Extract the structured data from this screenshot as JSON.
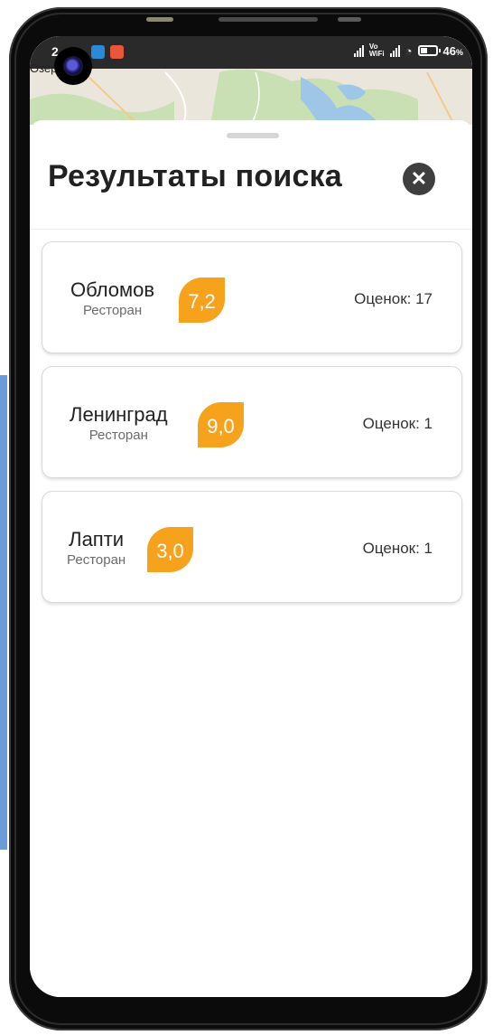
{
  "status_bar": {
    "time": "2",
    "vowifi_line1": "Vo",
    "vowifi_line2": "WiFi",
    "battery_percent": "46",
    "battery_unit": "%",
    "battery_level": 0.46
  },
  "map": {
    "label": "Озер    е"
  },
  "sheet": {
    "title": "Результаты поиска",
    "close_icon": "close-icon"
  },
  "results": [
    {
      "name": "Обломов",
      "type": "Ресторан",
      "rating": "7,2",
      "ratings_count": "Оценок: 17"
    },
    {
      "name": "Ленинград",
      "type": "Ресторан",
      "rating": "9,0",
      "ratings_count": "Оценок: 1"
    },
    {
      "name": "Лапти",
      "type": "Ресторан",
      "rating": "3,0",
      "ratings_count": "Оценок: 1"
    }
  ],
  "colors": {
    "rating_badge": "#f6a21d",
    "close_button": "#3f3f3f",
    "map_background": "#eae6dc",
    "map_water": "#9ec6e6",
    "map_forest": "#c8e0b4"
  }
}
